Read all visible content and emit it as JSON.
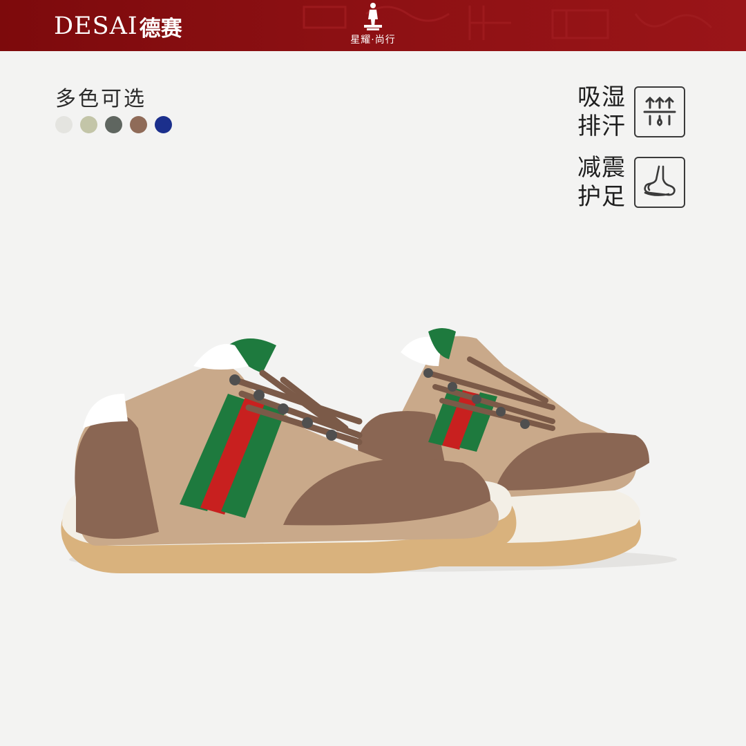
{
  "header": {
    "brand_latin": "DESAI",
    "brand_cjk": "德赛",
    "slogan": "星耀·尚行",
    "background_color": "#8c1013"
  },
  "colors_section": {
    "title": "多色可选",
    "swatches": [
      "#e4e4e0",
      "#c3c5a8",
      "#5f6660",
      "#8f6b58",
      "#1b2f8c"
    ]
  },
  "features": [
    {
      "lines": [
        "吸湿",
        "排汗"
      ],
      "icon": "moisture-wicking-icon"
    },
    {
      "lines": [
        "减震",
        "护足"
      ],
      "icon": "foot-cushion-icon"
    }
  ],
  "product": {
    "icon": "sneaker-pair-image",
    "colors": {
      "suede": "#8a6653",
      "canvas": "#c9a98a",
      "stripe_green": "#1e7a3e",
      "stripe_red": "#c8201f",
      "sole": "#f3efe6",
      "gum": "#d9b27d"
    }
  }
}
